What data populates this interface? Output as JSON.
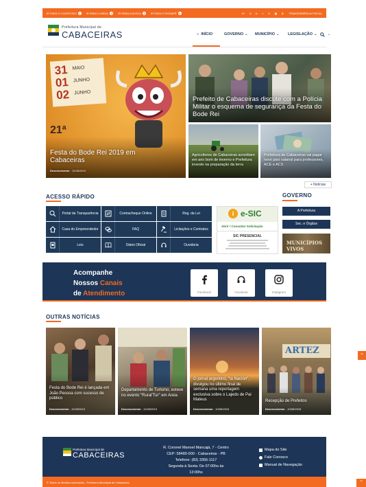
{
  "topbar": {
    "skip_links": [
      "IR PARA O CONTEÚDO",
      "IR PARA O MENU",
      "IR PARA A BUSCA",
      "IR PARA O RODAPÉ"
    ],
    "skip_keys": [
      "1",
      "2",
      "3",
      "4"
    ],
    "accessibility": [
      "A+",
      "A",
      "A-"
    ],
    "transparency": "TRANSPARÊNCIA FISCAL"
  },
  "header": {
    "logo_small": "Prefeitura Municipal de",
    "logo_big": "CABACEIRAS",
    "nav": [
      "INÍCIO",
      "GOVERNO",
      "MUNICÍPIO",
      "LEGISLAÇÃO"
    ]
  },
  "hero": {
    "main_dates": [
      "31",
      "MAIO",
      "01",
      "JUNHO",
      "02",
      "JUNHO"
    ],
    "main_edition": "21ª",
    "main_title": "Festa do Bode Rei 2019 em Cabaceiras",
    "main_meta_author": "Desenvolvedor",
    "main_meta_date": "11/06/2019",
    "top_right_title": "Prefeito de Cabaceiras discute com a Polícia Militar o esquema de segurança da Festa do Bode Rei",
    "bottom1_title": "Agricultores de Cabaceiras acreditam em ano bom de inverno e Prefeitura investe na preparação da terra",
    "bottom2_title": "Prefeitura de Cabaceiras vai pagar novo piso salarial para professores, ACE e ACS",
    "more_label": "+ Notícias"
  },
  "quick_access": {
    "title": "ACESSO RÁPIDO",
    "items": [
      {
        "label": "Portal da Transparência",
        "icon": "search-icon"
      },
      {
        "label": "Contracheque Online",
        "icon": "transfer-icon"
      },
      {
        "label": "Reg. da Lei",
        "icon": "document-icon"
      },
      {
        "label": "Casa do Empreendedor",
        "icon": "home-icon"
      },
      {
        "label": "FAQ",
        "icon": "chat-icon"
      },
      {
        "label": "Licitações e Contratos",
        "icon": "gavel-icon"
      },
      {
        "label": "Leis",
        "icon": "law-book-icon"
      },
      {
        "label": "Diário Oficial",
        "icon": "book-icon"
      },
      {
        "label": "Ouvidoria",
        "icon": "headset-icon"
      }
    ]
  },
  "esic": {
    "brand": "e-SIC",
    "link": "Abrir / Consultar Solicitação",
    "presencial": "SIC PRESENCIAL"
  },
  "governo": {
    "title": "GOVERNO",
    "buttons": [
      "A Prefeitura",
      "Sec. e Órgãos"
    ],
    "banner_text": "MUNICÍPIOS VIVOS"
  },
  "channels": {
    "line1": "Acompanhe",
    "line2a": "Nossos",
    "line2b": "Canais",
    "line3a": "de",
    "line3b": "Atendimento",
    "items": [
      "Facebook",
      "Ouvidoria",
      "Instagram"
    ]
  },
  "other_news": {
    "title": "OUTRAS NOTÍCIAS",
    "items": [
      {
        "title": "Festa do Bode Rei é lançada em João Pessoa com sucesso de público",
        "author": "Desenvolvedor",
        "date": "11/06/2019"
      },
      {
        "title": "Departamento de Turismo, esteve no evento \"Rural'Tur\" em Areia",
        "author": "Desenvolvedor",
        "date": "11/06/2019"
      },
      {
        "title": "O jornal argentino, \"la Nación\", divulgou no último final de semana uma reportagem exclusiva sobre o Lajedo de Pai Mateus",
        "author": "Desenvolvedor",
        "date": "10/06/2019"
      },
      {
        "title": "Recepção de Prefeitos",
        "author": "Desenvolvedor",
        "date": "10/06/2019"
      }
    ],
    "banner_text": "ARTEZ"
  },
  "footer": {
    "logo_small": "Prefeitura Municipal de",
    "logo_big": "CABACEIRAS",
    "address": [
      "R. Coronel Manoel Mancajá, 7 - Centro",
      "CEP: 58480-000 - Cabaceiras - PB",
      "Telefone: (83) 3356-1117",
      "Segunda à Sexta: De 07:00hs às",
      "13:00hs"
    ],
    "links": [
      "Mapa do Site",
      "Fale Conosco",
      "Manual de Navegação"
    ],
    "bottom_text": "© Todos os direitos reservados - Prefeitura Municipal de Cabaceiras"
  },
  "colors": {
    "accent": "#f26b21",
    "navy": "#1d3557"
  }
}
